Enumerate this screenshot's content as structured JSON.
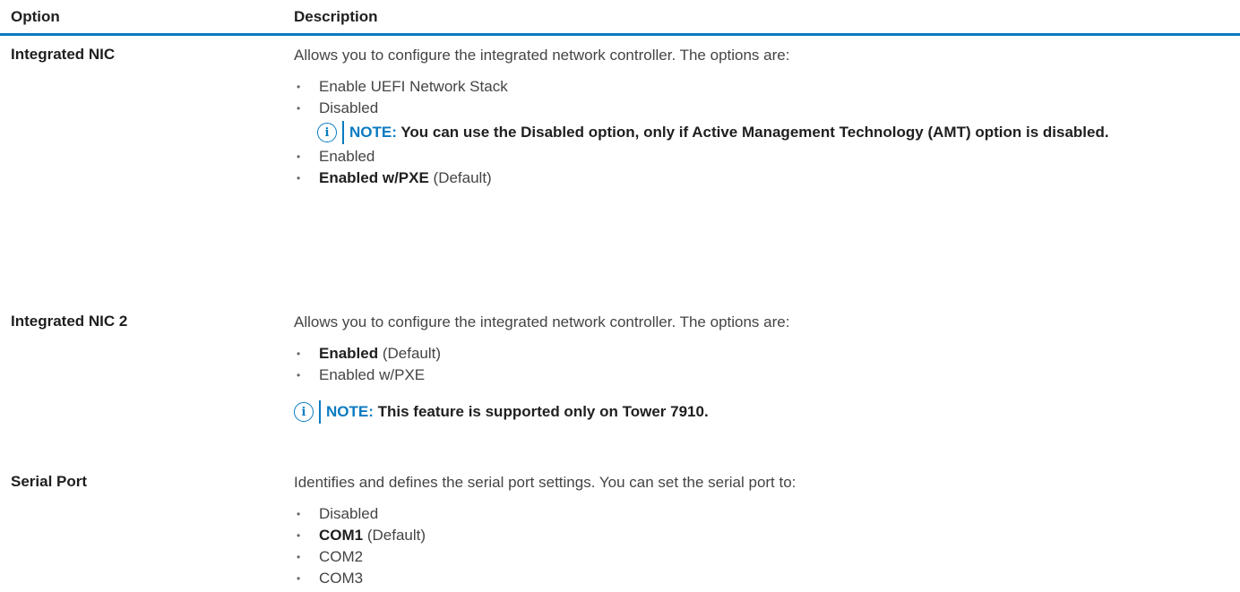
{
  "header": {
    "option": "Option",
    "description": "Description"
  },
  "rows": [
    {
      "option": "Integrated NIC",
      "description": "Allows you to configure the integrated network controller. The options are:",
      "items": [
        {
          "bold": "",
          "text": "Enable UEFI Network Stack"
        },
        {
          "bold": "",
          "text": "Disabled"
        },
        {
          "bold": "",
          "text": "Enabled"
        },
        {
          "bold": "Enabled w/PXE",
          "text": " (Default)"
        }
      ],
      "note": {
        "label": "NOTE:",
        "text": "You can use the Disabled option, only if Active Management Technology (AMT) option is disabled."
      }
    },
    {
      "option": "Integrated NIC 2",
      "description": "Allows you to configure the integrated network controller. The options are:",
      "items": [
        {
          "bold": "Enabled",
          "text": " (Default)"
        },
        {
          "bold": "",
          "text": "Enabled w/PXE"
        }
      ],
      "note": {
        "label": "NOTE:",
        "text": "This feature is supported only on Tower 7910."
      }
    },
    {
      "option": "Serial Port",
      "description": "Identifies and defines the serial port settings. You can set the serial port to:",
      "items": [
        {
          "bold": "",
          "text": "Disabled"
        },
        {
          "bold": "COM1",
          "text": " (Default)"
        },
        {
          "bold": "",
          "text": "COM2"
        },
        {
          "bold": "",
          "text": "COM3"
        }
      ]
    }
  ],
  "icons": {
    "info": "info-icon",
    "bullet": "•"
  },
  "colors": {
    "accent": "#0a7bc1",
    "heading_text": "#1f1f1f",
    "body_text": "#444444"
  }
}
